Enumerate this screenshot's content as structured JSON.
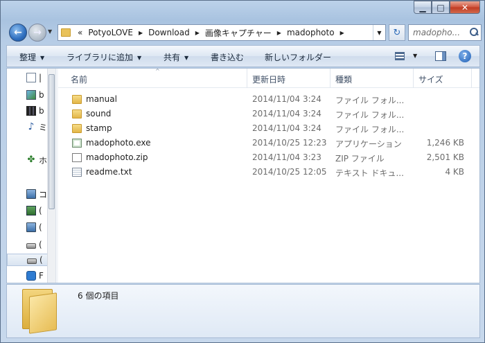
{
  "window": {
    "caption_buttons": {
      "minimize": "▁",
      "maximize": "□",
      "close": "✕"
    }
  },
  "address_bar": {
    "overflow": "«",
    "segments": [
      "PotyoLOVE",
      "Download",
      "画像キャプチャー",
      "madophoto"
    ],
    "separator": "▶",
    "dropdown": "▼"
  },
  "refresh": {
    "glyph": "↻",
    "icon": "refresh-icon"
  },
  "search": {
    "placeholder": "madopho..."
  },
  "toolbar": {
    "organize": "整理",
    "add_to_library": "ライブラリに追加",
    "share": "共有",
    "burn": "書き込む",
    "new_folder": "新しいフォルダー",
    "caret": "▼",
    "help": "?"
  },
  "nav_pane": {
    "items": [
      {
        "label": "ドキュメント",
        "visible": "|",
        "icon": "document-icon"
      },
      {
        "label": "b",
        "icon": "pictures-icon"
      },
      {
        "label": "b",
        "icon": "videos-icon"
      },
      {
        "label": "ミ",
        "icon": "music-icon"
      },
      {
        "label": "ホ・",
        "icon": "homegroup-icon"
      },
      {
        "label": "コ",
        "icon": "computer-icon"
      },
      {
        "label": "(",
        "icon": "network-drive-icon"
      },
      {
        "label": "(",
        "icon": "drive-icon"
      },
      {
        "label": "(",
        "icon": "hard-drive-icon"
      },
      {
        "label": "(",
        "icon": "hard-drive-icon"
      },
      {
        "label": "F",
        "icon": "app-icon"
      }
    ]
  },
  "columns": {
    "name": "名前",
    "date": "更新日時",
    "type": "種類",
    "size": "サイズ",
    "sort_caret": "^"
  },
  "files": [
    {
      "name": "manual",
      "date": "2014/11/04 3:24",
      "type": "ファイル フォル...",
      "size": "",
      "icon": "folder-icon"
    },
    {
      "name": "sound",
      "date": "2014/11/04 3:24",
      "type": "ファイル フォル...",
      "size": "",
      "icon": "folder-icon"
    },
    {
      "name": "stamp",
      "date": "2014/11/04 3:24",
      "type": "ファイル フォル...",
      "size": "",
      "icon": "folder-icon"
    },
    {
      "name": "madophoto.exe",
      "date": "2014/10/25 12:23",
      "type": "アプリケーション",
      "size": "1,246 KB",
      "icon": "exe-icon"
    },
    {
      "name": "madophoto.zip",
      "date": "2014/11/04 3:23",
      "type": "ZIP ファイル",
      "size": "2,501 KB",
      "icon": "zip-icon"
    },
    {
      "name": "readme.txt",
      "date": "2014/10/25 12:05",
      "type": "テキスト ドキュ...",
      "size": "4 KB",
      "icon": "text-file-icon"
    }
  ],
  "details": {
    "item_count": "6 個の項目"
  }
}
